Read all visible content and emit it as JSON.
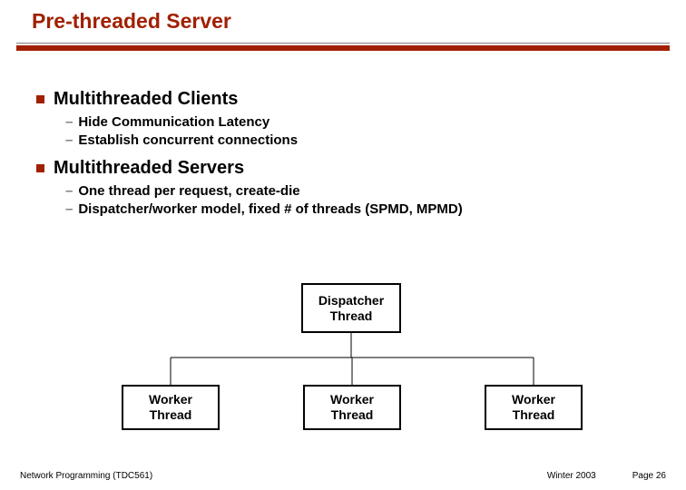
{
  "title": "Pre-threaded Server",
  "sections": [
    {
      "heading": "Multithreaded Clients",
      "items": [
        "Hide Communication Latency",
        "Establish concurrent connections"
      ]
    },
    {
      "heading": "Multithreaded Servers",
      "items": [
        "One thread per request, create-die",
        "Dispatcher/worker model, fixed # of threads (SPMD, MPMD)"
      ]
    }
  ],
  "diagram": {
    "dispatcher_l1": "Dispatcher",
    "dispatcher_l2": "Thread",
    "worker_l1": "Worker",
    "worker_l2": "Thread"
  },
  "footer": {
    "left": "Network Programming (TDC561)",
    "mid": "Winter 2003",
    "right": "Page 26"
  }
}
